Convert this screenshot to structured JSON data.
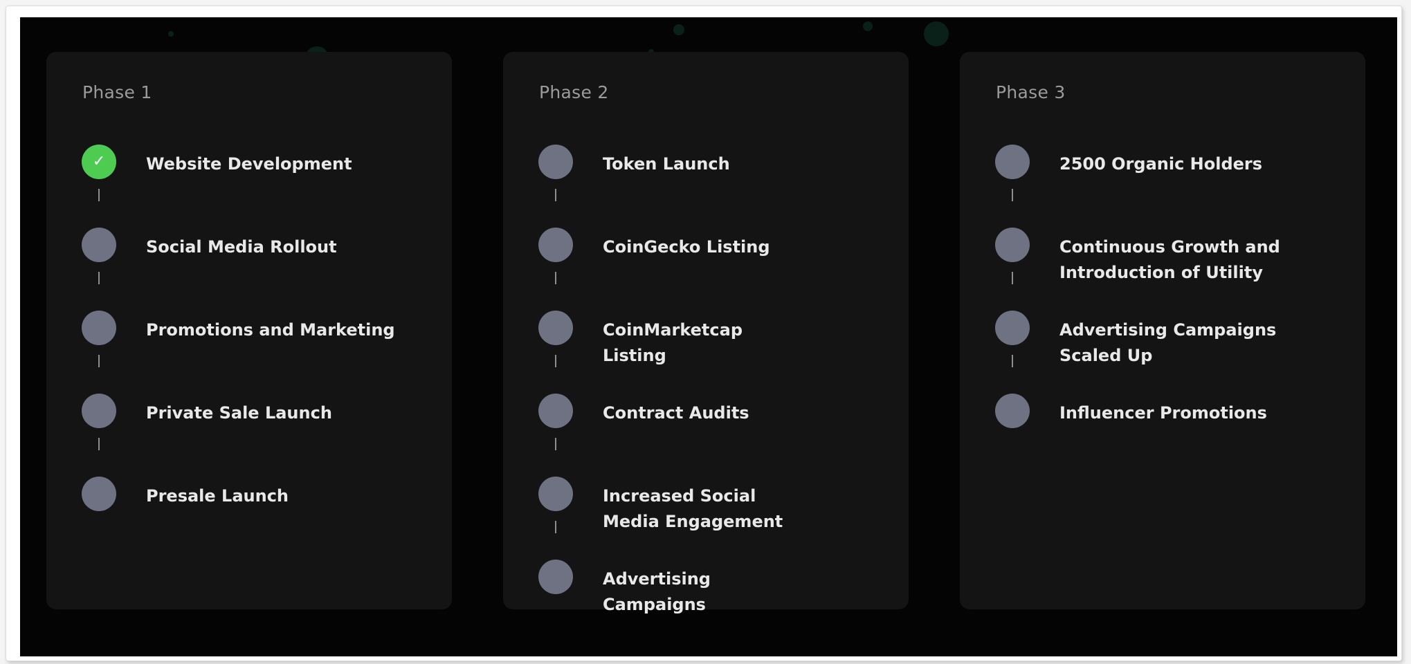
{
  "roadmap": {
    "phases": [
      {
        "title": "Phase 1",
        "items": [
          {
            "label": "Website Development",
            "completed": true
          },
          {
            "label": "Social Media Rollout",
            "completed": false
          },
          {
            "label": "Promotions and Marketing",
            "completed": false
          },
          {
            "label": "Private Sale Launch",
            "completed": false
          },
          {
            "label": "Presale Launch",
            "completed": false
          }
        ]
      },
      {
        "title": "Phase 2",
        "items": [
          {
            "label": "Token Launch",
            "completed": false
          },
          {
            "label": "CoinGecko Listing",
            "completed": false
          },
          {
            "label": "CoinMarketcap Listing",
            "completed": false
          },
          {
            "label": "Contract Audits",
            "completed": false
          },
          {
            "label": "Increased Social Media Engagement",
            "completed": false
          },
          {
            "label": "Advertising Campaigns",
            "completed": false
          }
        ]
      },
      {
        "title": "Phase 3",
        "items": [
          {
            "label": "2500 Organic Holders",
            "completed": false
          },
          {
            "label": "Continuous Growth and Introduction of Utility",
            "completed": false
          },
          {
            "label": "Advertising Campaigns Scaled Up",
            "completed": false
          },
          {
            "label": "Influencer Promotions",
            "completed": false
          }
        ]
      }
    ]
  },
  "colors": {
    "background": "#040404",
    "card": "#141414",
    "pending_dot": "#6f7282",
    "completed_dot": "#4ecc52",
    "phase_title": "#9b9b9b",
    "item_text": "#e9e9e9"
  },
  "icons": {
    "completed": "check-icon"
  }
}
